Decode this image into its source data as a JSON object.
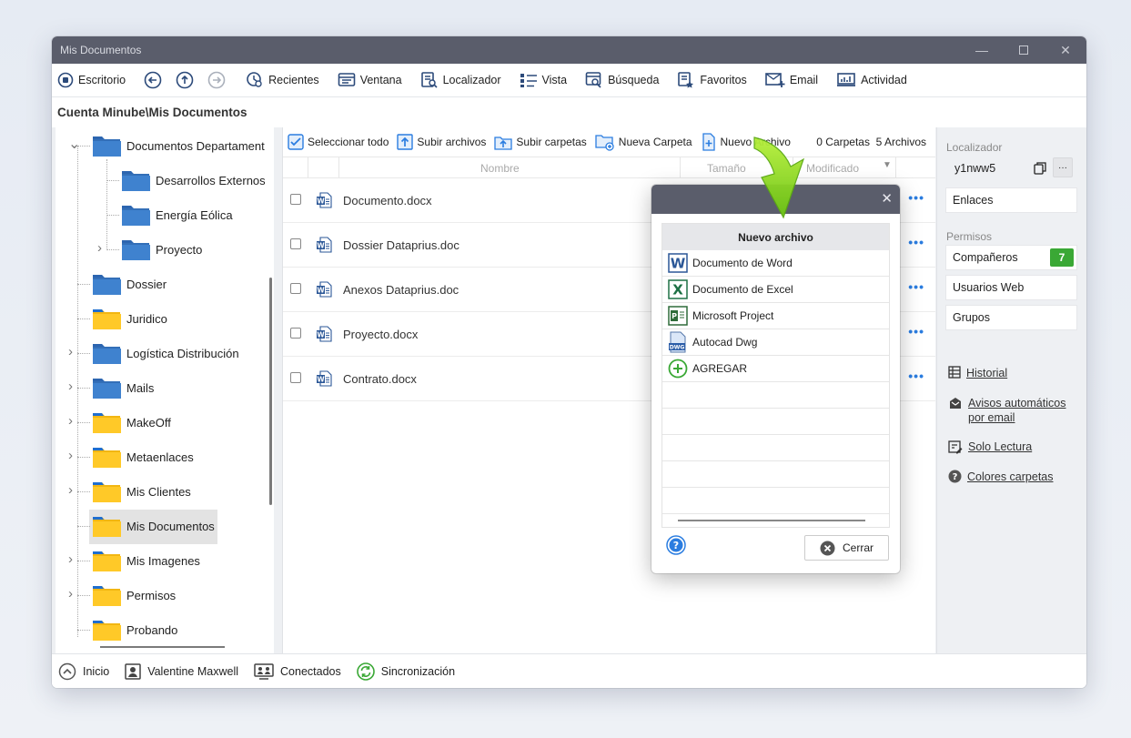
{
  "window": {
    "title": "Mis Documentos"
  },
  "toolbar": {
    "escritorio": "Escritorio",
    "recientes": "Recientes",
    "ventana": "Ventana",
    "localizador": "Localizador",
    "vista": "Vista",
    "busqueda": "Búsqueda",
    "favoritos": "Favoritos",
    "email": "Email",
    "actividad": "Actividad"
  },
  "path": "Cuenta Minube\\Mis Documentos",
  "tree": [
    {
      "label": "Documentos Departament",
      "color": "blue"
    },
    {
      "label": "Desarrollos Externos",
      "color": "blue"
    },
    {
      "label": "Energía Eólica",
      "color": "blue"
    },
    {
      "label": "Proyecto",
      "color": "blue"
    },
    {
      "label": "Dossier",
      "color": "blue"
    },
    {
      "label": "Juridico",
      "color": "yellow"
    },
    {
      "label": "Logística Distribución",
      "color": "blue"
    },
    {
      "label": "Mails",
      "color": "blue"
    },
    {
      "label": "MakeOff",
      "color": "yellow"
    },
    {
      "label": "Metaenlaces",
      "color": "yellow"
    },
    {
      "label": "Mis Clientes",
      "color": "yellow"
    },
    {
      "label": "Mis Documentos",
      "color": "yellow"
    },
    {
      "label": "Mis Imagenes",
      "color": "yellow"
    },
    {
      "label": "Permisos",
      "color": "yellow"
    },
    {
      "label": "Probando",
      "color": "yellow"
    }
  ],
  "files_toolbar": {
    "select_all": "Seleccionar todo",
    "upload_files": "Subir archivos",
    "upload_folders": "Subir carpetas",
    "new_folder": "Nueva Carpeta",
    "new_file": "Nuevo Archivo",
    "folders_count": "0 Carpetas",
    "files_count": "5 Archivos"
  },
  "columns": {
    "name": "Nombre",
    "size": "Tamaño",
    "modified": "Modificado"
  },
  "files": [
    {
      "name": "Documento.docx"
    },
    {
      "name": "Dossier Dataprius.doc"
    },
    {
      "name": "Anexos Dataprius.doc"
    },
    {
      "name": "Proyecto.docx"
    },
    {
      "name": "Contrato.docx"
    }
  ],
  "more_glyph": "•••",
  "right_panel": {
    "localizador_label": "Localizador",
    "localizador_value": "y1nww5",
    "copy_more": "···",
    "enlaces": "Enlaces",
    "permisos_label": "Permisos",
    "companeros": "Compañeros",
    "companeros_count": "7",
    "usuarios_web": "Usuarios Web",
    "grupos": "Grupos",
    "historial": "Historial",
    "avisos_1": "Avisos automáticos",
    "avisos_2": "por email",
    "solo_lectura": "Solo Lectura",
    "colores": "Colores carpetas",
    "accent_green": "#3aa835"
  },
  "statusbar": {
    "inicio": "Inicio",
    "user": "Valentine Maxwell",
    "conectados": "Conectados",
    "sync": "Sincronización"
  },
  "dialog": {
    "title": "Nuevo archivo",
    "items": [
      {
        "label": "Documento de Word",
        "icon": "word-icon"
      },
      {
        "label": "Documento de Excel",
        "icon": "excel-icon"
      },
      {
        "label": "Microsoft Project",
        "icon": "project-icon"
      },
      {
        "label": "Autocad Dwg",
        "icon": "dwg-icon"
      },
      {
        "label": "AGREGAR",
        "icon": "add-icon"
      }
    ],
    "close_label": "Cerrar",
    "help_glyph": "?"
  }
}
